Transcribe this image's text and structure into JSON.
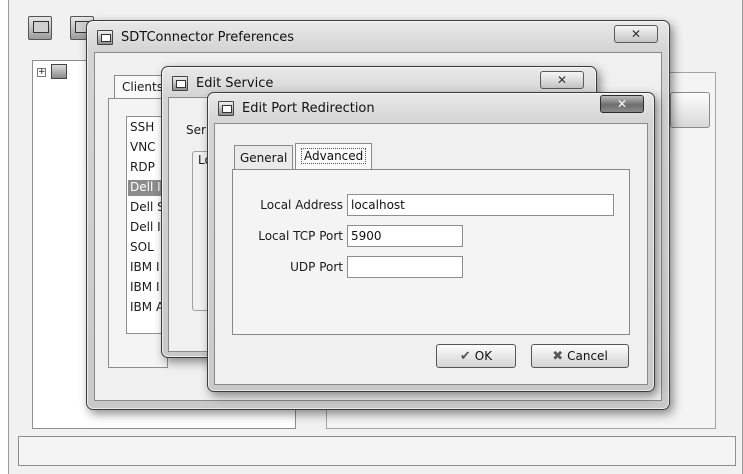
{
  "preferences_window": {
    "title": "SDTConnector Preferences",
    "close_glyph": "✕",
    "tab_clients": "Clients",
    "services": [
      {
        "label": "SSH",
        "selected": false
      },
      {
        "label": "VNC",
        "selected": false
      },
      {
        "label": "RDP",
        "selected": false
      },
      {
        "label": "Dell I",
        "selected": true
      },
      {
        "label": "Dell S",
        "selected": false
      },
      {
        "label": "Dell I",
        "selected": false
      },
      {
        "label": "SOL",
        "selected": false
      },
      {
        "label": "IBM I",
        "selected": false
      },
      {
        "label": "IBM I",
        "selected": false
      },
      {
        "label": "IBM A",
        "selected": false
      }
    ],
    "tree_expander": "+"
  },
  "edit_service_window": {
    "title": "Edit Service",
    "close_glyph": "✕",
    "service_label": "Ser",
    "group_label": "Lo"
  },
  "edit_port_window": {
    "title": "Edit Port Redirection",
    "close_glyph": "✕",
    "tabs": {
      "general": "General",
      "advanced": "Advanced"
    },
    "fields": {
      "local_address": {
        "label": "Local Address",
        "value": "localhost"
      },
      "local_tcp_port": {
        "label": "Local TCP Port",
        "value": "5900"
      },
      "udp_port": {
        "label": "UDP Port",
        "value": ""
      }
    },
    "ok_button": {
      "label": "OK",
      "icon": "check-icon"
    },
    "cancel_button": {
      "label": "Cancel",
      "icon": "cancel-x-icon"
    }
  }
}
